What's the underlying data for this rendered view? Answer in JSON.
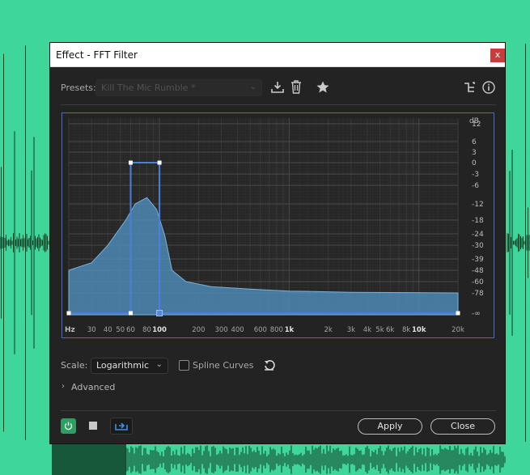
{
  "dialog": {
    "title": "Effect - FFT Filter",
    "close_label": "x"
  },
  "presets": {
    "label": "Presets:",
    "value": "Kill The Mic Rumble *"
  },
  "icons": [
    "save-preset-icon",
    "delete-preset-icon",
    "favorite-star-icon",
    "routing-icon",
    "info-icon"
  ],
  "graph": {
    "db_unit": "dB",
    "db_ticks": [
      "12",
      "6",
      "3",
      "0",
      "-3",
      "-6",
      "-12",
      "-18",
      "-24",
      "-30",
      "-39",
      "-48",
      "-60",
      "-78",
      "-∞"
    ],
    "hz_unit": "Hz",
    "hz_ticks": [
      "30",
      "40",
      "50",
      "60",
      "80",
      "100",
      "200",
      "300",
      "400",
      "600",
      "800",
      "1k",
      "2k",
      "3k",
      "4k",
      "5k",
      "6k",
      "8k",
      "10k",
      "20k"
    ],
    "bold_hz_ticks": [
      "100",
      "1k",
      "10k"
    ],
    "filter_points": [
      {
        "freq_hz": 20,
        "db": "-∞"
      },
      {
        "freq_hz": 60,
        "db": "-∞"
      },
      {
        "freq_hz": 60,
        "db": 0
      },
      {
        "freq_hz": 100,
        "db": 0
      },
      {
        "freq_hz": 100,
        "db": "-∞"
      },
      {
        "freq_hz": 20000,
        "db": "-∞"
      }
    ],
    "colors": {
      "line": "#4a7fe0",
      "spectrum": "#5b9fca",
      "accent": "#2e9e63"
    }
  },
  "scale": {
    "label": "Scale:",
    "value": "Logarithmic"
  },
  "spline": {
    "label": "Spline Curves",
    "checked": false
  },
  "advanced": {
    "label": "Advanced"
  },
  "footer": {
    "apply_label": "Apply",
    "close_label": "Close"
  }
}
